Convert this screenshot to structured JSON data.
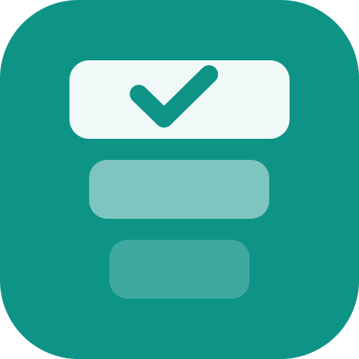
{
  "app_icon": {
    "icon_name": "task-priority-stack-icon",
    "colors": {
      "tile_background": "#0E9387",
      "top_bar": "#F1F8F8",
      "middle_bar": "#7DC5BE",
      "bottom_bar": "#3FA9A0",
      "checkmark": "#0E9387"
    },
    "layers": [
      {
        "name": "checked-item-bar",
        "has_checkmark": true
      },
      {
        "name": "middle-item-bar",
        "has_checkmark": false
      },
      {
        "name": "bottom-item-bar",
        "has_checkmark": false
      }
    ]
  }
}
